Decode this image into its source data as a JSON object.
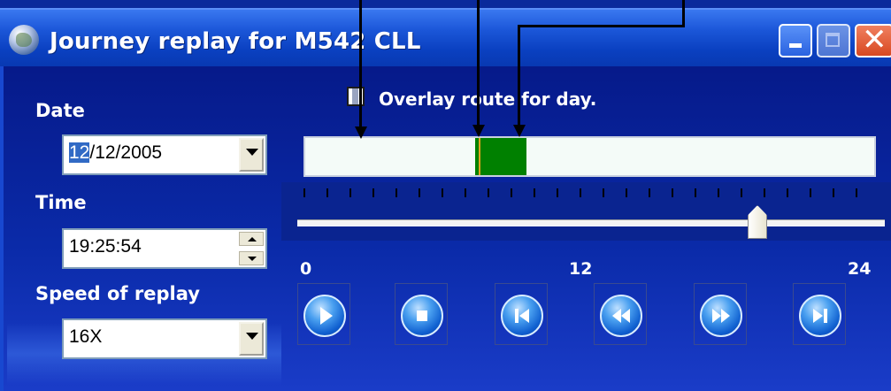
{
  "window": {
    "title": "Journey replay for M542 CLL",
    "icon": "globe-icon",
    "controls": [
      "minimize-icon",
      "maximize-icon",
      "close-icon"
    ]
  },
  "date": {
    "label": "Date",
    "value_selected": "12",
    "value_rest": "/12/2005"
  },
  "time": {
    "label": "Time",
    "value": "19:25:54"
  },
  "speed": {
    "label": "Speed of replay",
    "value": "16X"
  },
  "overlay": {
    "label": "Overlay route for day.",
    "checked": false
  },
  "timeline": {
    "scale_start": "0",
    "scale_mid": "12",
    "scale_end": "24",
    "slider_position_fraction": 0.8,
    "route_color": "#008000",
    "cursor_color": "#e0a020"
  },
  "playback_buttons": [
    "play-icon",
    "stop-icon",
    "skip-back-icon",
    "rewind-icon",
    "fast-forward-icon",
    "skip-forward-icon"
  ],
  "colors": {
    "title_bar": "#1b56d8",
    "client_bg": "#0a2aa8",
    "close_button": "#d84820"
  }
}
